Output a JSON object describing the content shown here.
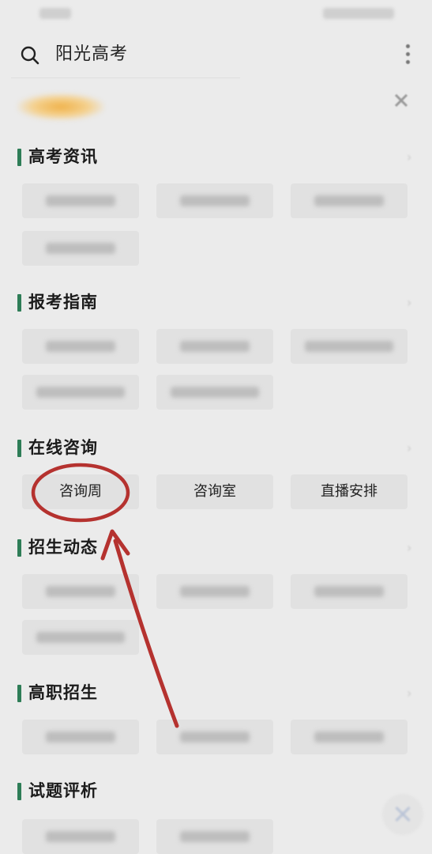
{
  "search": {
    "text": "阳光高考"
  },
  "sections": [
    {
      "title": "高考资讯",
      "tags": [
        "",
        "",
        "",
        ""
      ]
    },
    {
      "title": "报考指南",
      "tags": [
        "",
        "",
        "",
        "",
        ""
      ]
    },
    {
      "title": "在线咨询",
      "tags": [
        "咨询周",
        "咨询室",
        "直播安排"
      ]
    },
    {
      "title": "招生动态",
      "tags": [
        "",
        "",
        "",
        ""
      ]
    },
    {
      "title": "高职招生",
      "tags": [
        "",
        "",
        ""
      ]
    },
    {
      "title": "试题评析",
      "tags": [
        "",
        ""
      ]
    }
  ],
  "colors": {
    "accent_bar": "#2e7d57",
    "annotation_red": "#b5322f"
  },
  "icons": [
    "search-icon",
    "more-icon",
    "close-icon",
    "chevron-right-icon",
    "float-close-icon"
  ]
}
